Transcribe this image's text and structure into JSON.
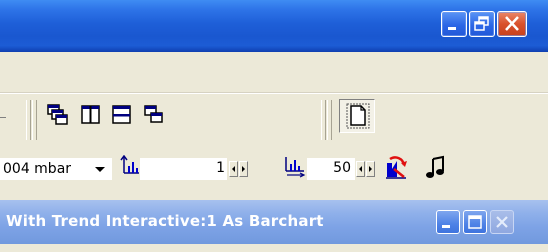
{
  "main_window": {
    "controls": [
      "minimize-icon",
      "restore-icon",
      "close-icon"
    ]
  },
  "toolbar_top": {
    "buttons": [
      "cascade-windows-icon",
      "tile-vertical-icon",
      "tile-horizontal-icon",
      "arrange-windows-icon",
      "new-page-icon"
    ]
  },
  "toolbar_bottom": {
    "pressure_value": "004 mbar",
    "spin1_value": "1",
    "spin2_value": "50",
    "icons": [
      "y-axis-scale-icon",
      "x-axis-scale-icon",
      "chart-reset-icon",
      "music-note-icon"
    ]
  },
  "child_window": {
    "title": "With Trend Interactive:1 As Barchart",
    "controls": [
      "minimize-icon",
      "maximize-icon",
      "close-icon"
    ]
  },
  "colors": {
    "titlebar_blue": "#1E5FD8",
    "child_title_blue": "#7EA3E6",
    "close_red": "#D9512C",
    "toolbar_bg": "#ECE9D8"
  }
}
